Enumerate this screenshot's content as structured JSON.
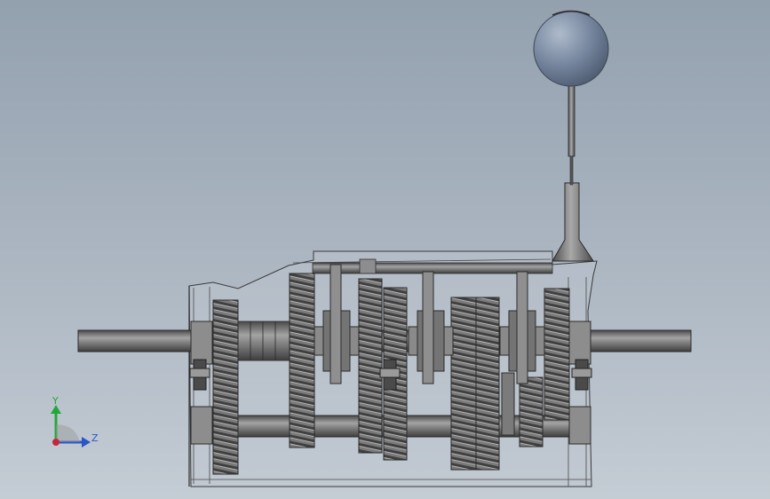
{
  "triad": {
    "y_label": "Y",
    "z_label": "Z",
    "y_color": "#22a83a",
    "z_color": "#2b56c8",
    "origin_color": "#c8243a"
  },
  "colors": {
    "metal": "#5e5e5e",
    "metal_light": "#9a9a9a",
    "gear": "#6f6f6f",
    "outline": "#2c2c2c",
    "housing_fill": "#b9c0c8",
    "knob": "#6f7f95"
  }
}
